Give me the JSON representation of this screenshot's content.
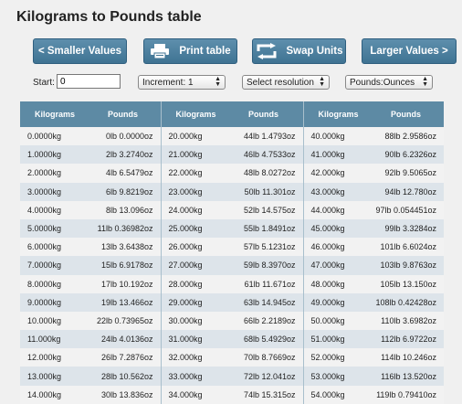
{
  "title": "Kilograms to Pounds table",
  "buttons": {
    "smaller": "< Smaller Values",
    "print": "Print table",
    "swap": "Swap Units",
    "larger": "Larger Values >"
  },
  "controls": {
    "start_label": "Start:",
    "start_value": "0",
    "increment": "Increment: 1",
    "resolution": "Select resolution",
    "format": "Pounds:Ounces"
  },
  "table": {
    "headers": [
      "Kilograms",
      "Pounds",
      "Kilograms",
      "Pounds",
      "Kilograms",
      "Pounds"
    ],
    "rows": [
      [
        "0.0000kg",
        "0lb 0.0000oz",
        "20.000kg",
        "44lb 1.4793oz",
        "40.000kg",
        "88lb 2.9586oz"
      ],
      [
        "1.0000kg",
        "2lb 3.2740oz",
        "21.000kg",
        "46lb 4.7533oz",
        "41.000kg",
        "90lb 6.2326oz"
      ],
      [
        "2.0000kg",
        "4lb 6.5479oz",
        "22.000kg",
        "48lb 8.0272oz",
        "42.000kg",
        "92lb 9.5065oz"
      ],
      [
        "3.0000kg",
        "6lb 9.8219oz",
        "23.000kg",
        "50lb 11.301oz",
        "43.000kg",
        "94lb 12.780oz"
      ],
      [
        "4.0000kg",
        "8lb 13.096oz",
        "24.000kg",
        "52lb 14.575oz",
        "44.000kg",
        "97lb 0.054451oz"
      ],
      [
        "5.0000kg",
        "11lb 0.36982oz",
        "25.000kg",
        "55lb 1.8491oz",
        "45.000kg",
        "99lb 3.3284oz"
      ],
      [
        "6.0000kg",
        "13lb 3.6438oz",
        "26.000kg",
        "57lb 5.1231oz",
        "46.000kg",
        "101lb 6.6024oz"
      ],
      [
        "7.0000kg",
        "15lb 6.9178oz",
        "27.000kg",
        "59lb 8.3970oz",
        "47.000kg",
        "103lb 9.8763oz"
      ],
      [
        "8.0000kg",
        "17lb 10.192oz",
        "28.000kg",
        "61lb 11.671oz",
        "48.000kg",
        "105lb 13.150oz"
      ],
      [
        "9.0000kg",
        "19lb 13.466oz",
        "29.000kg",
        "63lb 14.945oz",
        "49.000kg",
        "108lb 0.42428oz"
      ],
      [
        "10.000kg",
        "22lb 0.73965oz",
        "30.000kg",
        "66lb 2.2189oz",
        "50.000kg",
        "110lb 3.6982oz"
      ],
      [
        "11.000kg",
        "24lb 4.0136oz",
        "31.000kg",
        "68lb 5.4929oz",
        "51.000kg",
        "112lb 6.9722oz"
      ],
      [
        "12.000kg",
        "26lb 7.2876oz",
        "32.000kg",
        "70lb 8.7669oz",
        "52.000kg",
        "114lb 10.246oz"
      ],
      [
        "13.000kg",
        "28lb 10.562oz",
        "33.000kg",
        "72lb 12.041oz",
        "53.000kg",
        "116lb 13.520oz"
      ],
      [
        "14.000kg",
        "30lb 13.836oz",
        "34.000kg",
        "74lb 15.315oz",
        "54.000kg",
        "119lb 0.79410oz"
      ]
    ]
  },
  "icons": {
    "print": "printer-icon",
    "swap": "swap-arrows-icon"
  },
  "colors": {
    "button": "#4b7f9f",
    "header": "#5d8aa4",
    "row_alt": "#dde4ea"
  }
}
